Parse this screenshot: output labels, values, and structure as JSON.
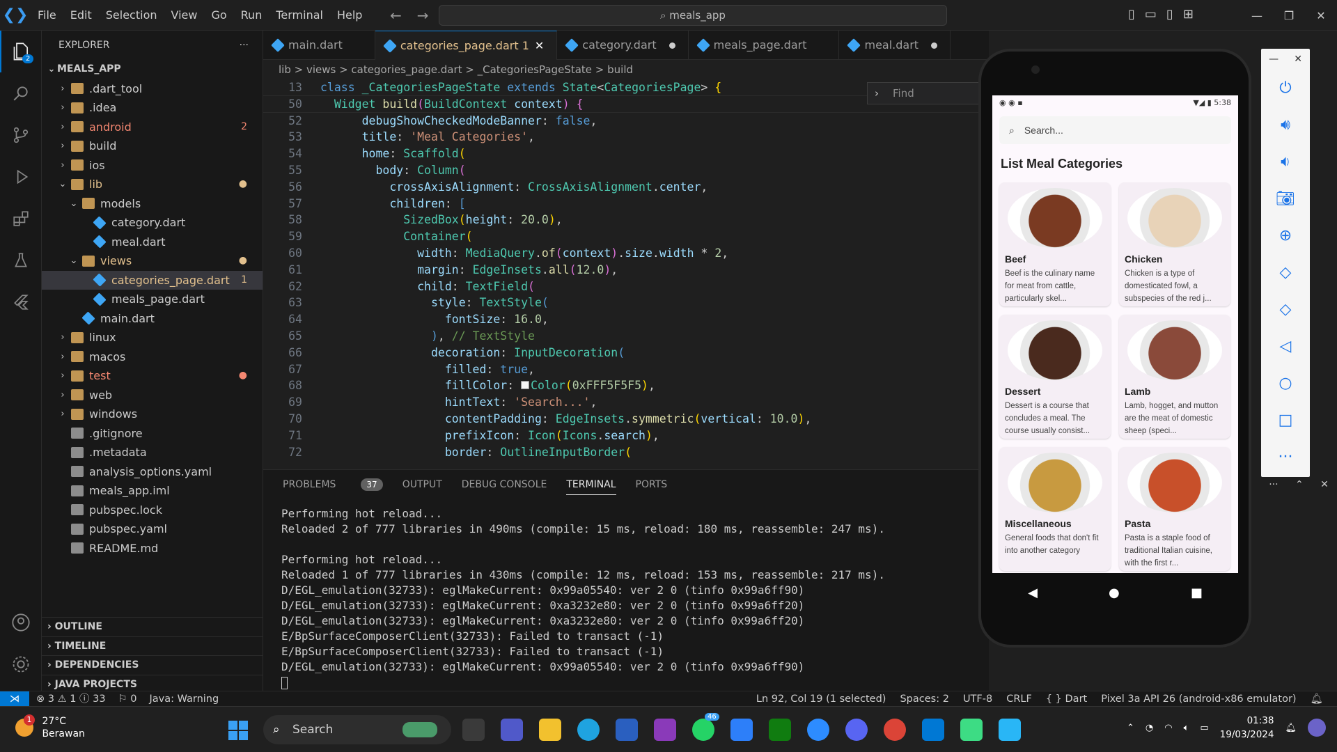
{
  "menu": [
    "File",
    "Edit",
    "Selection",
    "View",
    "Go",
    "Run",
    "Terminal",
    "Help"
  ],
  "command_center": "meals_app",
  "explorer": {
    "title": "EXPLORER",
    "project": "MEALS_APP",
    "items": [
      {
        "label": ".dart_tool",
        "indent": 1,
        "type": "folder",
        "open": false
      },
      {
        "label": ".idea",
        "indent": 1,
        "type": "folder",
        "open": false
      },
      {
        "label": "android",
        "indent": 1,
        "type": "folder",
        "open": false,
        "status": "2",
        "color": "#f48771"
      },
      {
        "label": "build",
        "indent": 1,
        "type": "folder",
        "open": false
      },
      {
        "label": "ios",
        "indent": 1,
        "type": "folder",
        "open": false
      },
      {
        "label": "lib",
        "indent": 1,
        "type": "folder",
        "open": true,
        "status": "●",
        "color": "#e2c08d"
      },
      {
        "label": "models",
        "indent": 2,
        "type": "folder",
        "open": true
      },
      {
        "label": "category.dart",
        "indent": 3,
        "type": "dart"
      },
      {
        "label": "meal.dart",
        "indent": 3,
        "type": "dart"
      },
      {
        "label": "views",
        "indent": 2,
        "type": "folder",
        "open": true,
        "status": "●",
        "color": "#e2c08d"
      },
      {
        "label": "categories_page.dart",
        "indent": 3,
        "type": "dart",
        "status": "1",
        "color": "#e2c08d",
        "selected": true
      },
      {
        "label": "meals_page.dart",
        "indent": 3,
        "type": "dart"
      },
      {
        "label": "main.dart",
        "indent": 2,
        "type": "dart"
      },
      {
        "label": "linux",
        "indent": 1,
        "type": "folder",
        "open": false
      },
      {
        "label": "macos",
        "indent": 1,
        "type": "folder",
        "open": false
      },
      {
        "label": "test",
        "indent": 1,
        "type": "folder",
        "open": false,
        "status": "●",
        "color": "#f48771"
      },
      {
        "label": "web",
        "indent": 1,
        "type": "folder",
        "open": false
      },
      {
        "label": "windows",
        "indent": 1,
        "type": "folder",
        "open": false
      },
      {
        "label": ".gitignore",
        "indent": 1,
        "type": "file"
      },
      {
        "label": ".metadata",
        "indent": 1,
        "type": "file"
      },
      {
        "label": "analysis_options.yaml",
        "indent": 1,
        "type": "file"
      },
      {
        "label": "meals_app.iml",
        "indent": 1,
        "type": "file"
      },
      {
        "label": "pubspec.lock",
        "indent": 1,
        "type": "file"
      },
      {
        "label": "pubspec.yaml",
        "indent": 1,
        "type": "file"
      },
      {
        "label": "README.md",
        "indent": 1,
        "type": "file"
      }
    ],
    "sections": [
      "OUTLINE",
      "TIMELINE",
      "DEPENDENCIES",
      "JAVA PROJECTS"
    ]
  },
  "tabs": [
    {
      "label": "main.dart",
      "active": false,
      "modified": false
    },
    {
      "label": "categories_page.dart 1",
      "active": true,
      "modified": false
    },
    {
      "label": "category.dart",
      "active": false,
      "modified": true
    },
    {
      "label": "meals_page.dart",
      "active": false,
      "modified": false
    },
    {
      "label": "meal.dart",
      "active": false,
      "modified": true
    }
  ],
  "breadcrumb": "lib > views > categories_page.dart > _CategoriesPageState > build",
  "find_placeholder": "Find",
  "code_lines": [
    {
      "n": "13",
      "html": "<span class='k'>class</span> <span class='t'>_CategoriesPageState</span> <span class='k'>extends</span> <span class='t'>State</span>&lt;<span class='t'>CategoriesPage</span>&gt; <span class='y'>{</span>",
      "sticky": true
    },
    {
      "n": "50",
      "html": "  <span class='t'>Widget</span> <span class='f'>build</span><span class='m'>(</span><span class='t'>BuildContext</span> <span class='p'>context</span><span class='m'>)</span> <span class='m'>{</span>",
      "sticky": true
    },
    {
      "n": "52",
      "html": "      <span class='p'>debugShowCheckedModeBanner</span>: <span class='k'>false</span>,"
    },
    {
      "n": "53",
      "html": "      <span class='p'>title</span>: <span class='s'>'Meal Categories'</span>,"
    },
    {
      "n": "54",
      "html": "      <span class='p'>home</span>: <span class='t'>Scaffold</span><span class='y'>(</span>"
    },
    {
      "n": "55",
      "html": "        <span class='p'>body</span>: <span class='t'>Column</span><span class='m'>(</span>"
    },
    {
      "n": "56",
      "html": "          <span class='p'>crossAxisAlignment</span>: <span class='t'>CrossAxisAlignment</span>.<span class='p'>center</span>,"
    },
    {
      "n": "57",
      "html": "          <span class='p'>children</span>: <span class='k'>[</span>"
    },
    {
      "n": "58",
      "html": "            <span class='t'>SizedBox</span><span class='y'>(</span><span class='p'>height</span>: <span class='n'>20.0</span><span class='y'>)</span>,"
    },
    {
      "n": "59",
      "html": "            <span class='t'>Container</span><span class='y'>(</span>"
    },
    {
      "n": "60",
      "html": "              <span class='p'>width</span>: <span class='t'>MediaQuery</span>.<span class='f'>of</span><span class='m'>(</span><span class='p'>context</span><span class='m'>)</span>.<span class='p'>size</span>.<span class='p'>width</span> * <span class='n'>2</span>,"
    },
    {
      "n": "61",
      "html": "              <span class='p'>margin</span>: <span class='t'>EdgeInsets</span>.<span class='f'>all</span><span class='m'>(</span><span class='n'>12.0</span><span class='m'>)</span>,"
    },
    {
      "n": "62",
      "html": "              <span class='p'>child</span>: <span class='t'>TextField</span><span class='m'>(</span>"
    },
    {
      "n": "63",
      "html": "                <span class='p'>style</span>: <span class='t'>TextStyle</span><span class='k'>(</span>"
    },
    {
      "n": "64",
      "html": "                  <span class='p'>fontSize</span>: <span class='n'>16.0</span>,"
    },
    {
      "n": "65",
      "html": "                <span class='k'>)</span>, <span class='c'>// TextStyle</span>"
    },
    {
      "n": "66",
      "html": "                <span class='p'>decoration</span>: <span class='t'>InputDecoration</span><span class='k'>(</span>"
    },
    {
      "n": "67",
      "html": "                  <span class='p'>filled</span>: <span class='k'>true</span>,"
    },
    {
      "n": "68",
      "html": "                  <span class='p'>fillColor</span>: <span style='display:inline-block;width:12px;height:12px;background:#f5f5f5;border:1px solid #888;margin-right:2px'></span><span class='t'>Color</span><span class='y'>(</span><span class='n'>0xFFF5F5F5</span><span class='y'>)</span>,"
    },
    {
      "n": "69",
      "html": "                  <span class='p'>hintText</span>: <span class='s'>'Search...'</span>,"
    },
    {
      "n": "70",
      "html": "                  <span class='p'>contentPadding</span>: <span class='t'>EdgeInsets</span>.<span class='f'>symmetric</span><span class='y'>(</span><span class='p'>vertical</span>: <span class='n'>10.0</span><span class='y'>)</span>,"
    },
    {
      "n": "71",
      "html": "                  <span class='p'>prefixIcon</span>: <span class='t'>Icon</span><span class='y'>(</span><span class='t'>Icons</span>.<span class='p'>search</span><span class='y'>)</span>,"
    },
    {
      "n": "72",
      "html": "                  <span class='p'>border</span>: <span class='t'>OutlineInputBorder</span><span class='y'>(</span>"
    }
  ],
  "panel": {
    "tabs": [
      "PROBLEMS",
      "OUTPUT",
      "DEBUG CONSOLE",
      "TERMINAL",
      "PORTS"
    ],
    "problems_count": "37",
    "terminal_lines": [
      "Performing hot reload...",
      "Reloaded 2 of 777 libraries in 490ms (compile: 15 ms, reload: 180 ms, reassemble: 247 ms).",
      "",
      "Performing hot reload...",
      "Reloaded 1 of 777 libraries in 430ms (compile: 12 ms, reload: 153 ms, reassemble: 217 ms).",
      "D/EGL_emulation(32733): eglMakeCurrent: 0x99a05540: ver 2 0 (tinfo 0x99a6ff90)",
      "D/EGL_emulation(32733): eglMakeCurrent: 0xa3232e80: ver 2 0 (tinfo 0x99a6ff20)",
      "D/EGL_emulation(32733): eglMakeCurrent: 0xa3232e80: ver 2 0 (tinfo 0x99a6ff20)",
      "E/BpSurfaceComposerClient(32733): Failed to transact (-1)",
      "E/BpSurfaceComposerClient(32733): Failed to transact (-1)",
      "D/EGL_emulation(32733): eglMakeCurrent: 0x99a05540: ver 2 0 (tinfo 0x99a6ff90)"
    ]
  },
  "statusbar": {
    "left": [
      "⊗ 3 ⚠ 1 ⓘ 33",
      "⚐ 0",
      "Java: Warning"
    ],
    "right": [
      "Ln 92, Col 19 (1 selected)",
      "Spaces: 2",
      "UTF-8",
      "CRLF",
      "{ } Dart",
      "Pixel 3a API 26 (android-x86 emulator)"
    ]
  },
  "taskbar": {
    "weather_temp": "27°C",
    "weather_desc": "Berawan",
    "weather_badge": "1",
    "search": "Search",
    "whatsapp_badge": "46",
    "time": "01:38",
    "date": "19/03/2024"
  },
  "phone": {
    "time": "5:38",
    "search_hint": "Search...",
    "title": "List Meal Categories",
    "categories": [
      {
        "name": "Beef",
        "desc": "Beef is the culinary name for meat from cattle, particularly skel...",
        "color": "#7a3a22"
      },
      {
        "name": "Chicken",
        "desc": "Chicken is a type of domesticated fowl, a subspecies of the red j...",
        "color": "#e8d3b8"
      },
      {
        "name": "Dessert",
        "desc": "Dessert is a course that concludes a meal. The course usually consist...",
        "color": "#4a2a1e"
      },
      {
        "name": "Lamb",
        "desc": "Lamb, hogget, and mutton are the meat of domestic sheep (speci...",
        "color": "#8a4a3a"
      },
      {
        "name": "Miscellaneous",
        "desc": "General foods that don't fit into another category",
        "color": "#c89a40"
      },
      {
        "name": "Pasta",
        "desc": "Pasta is a staple food of traditional Italian cuisine, with the first r...",
        "color": "#c8502a"
      }
    ]
  }
}
